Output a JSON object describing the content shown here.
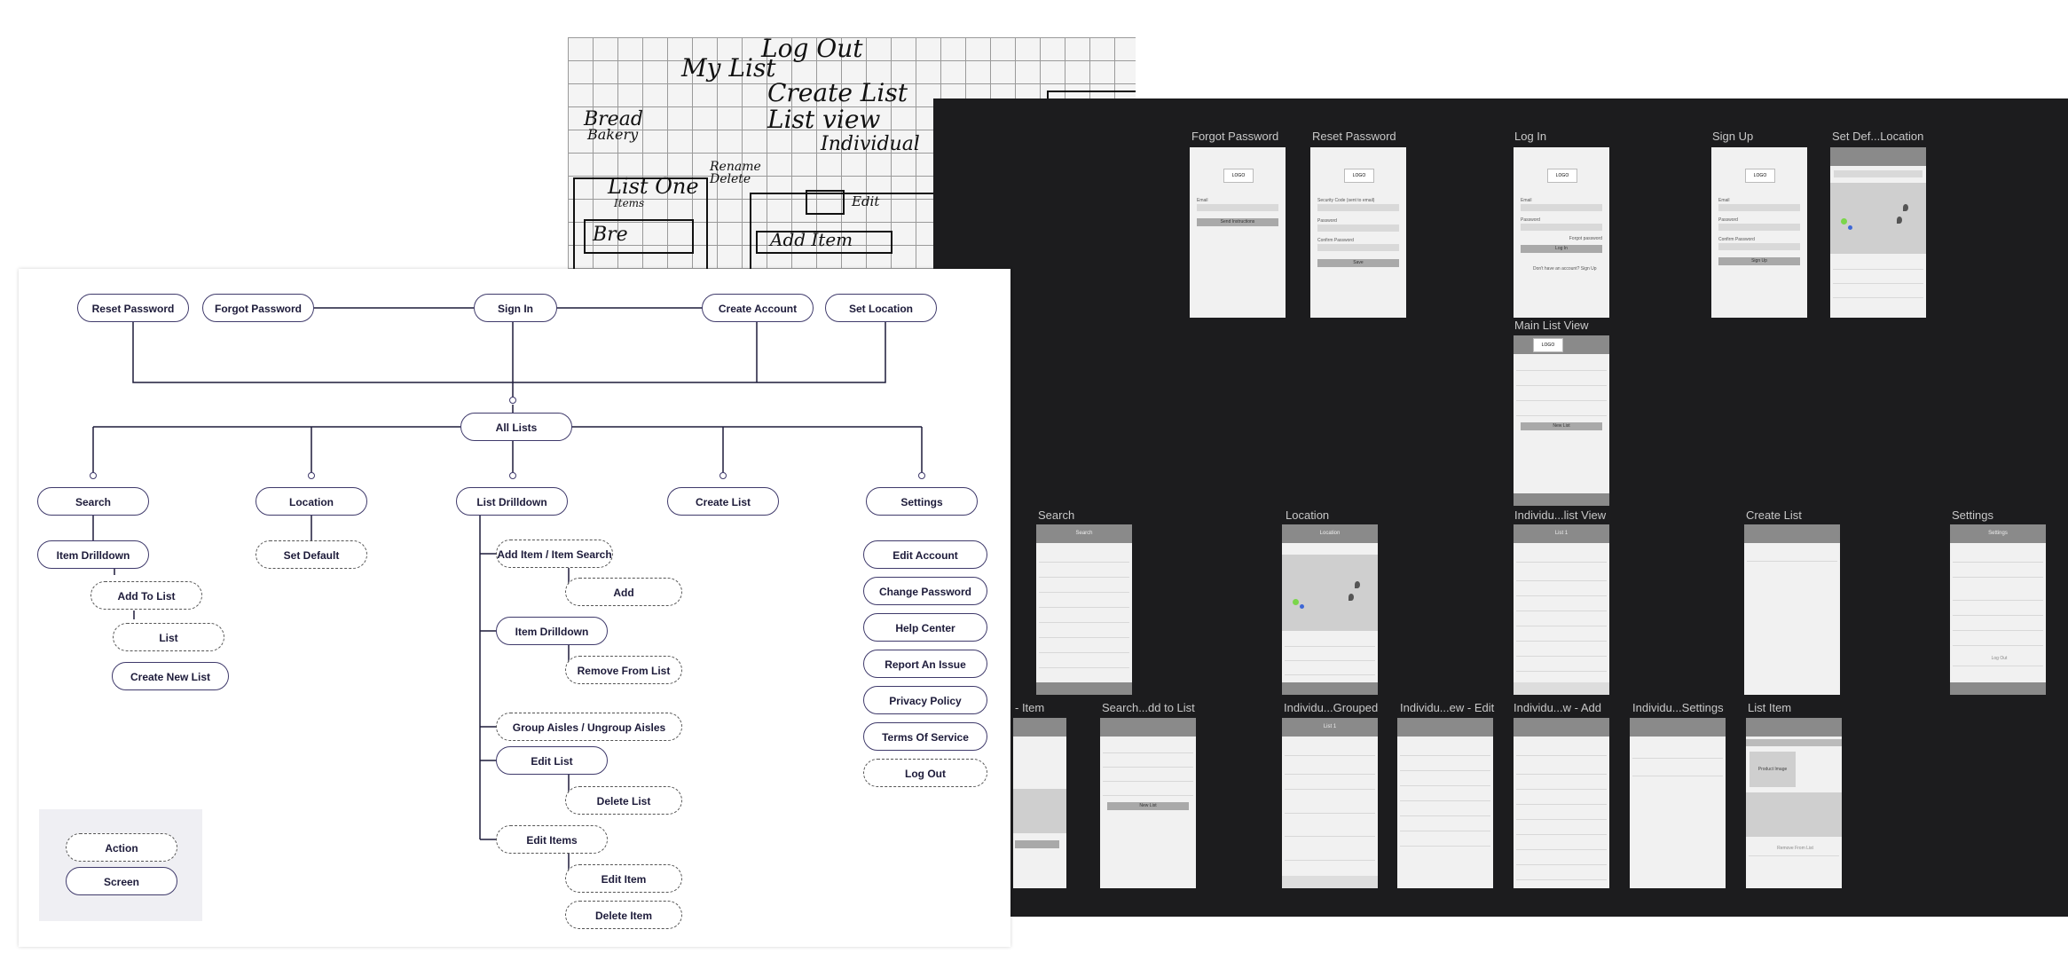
{
  "sketch": {
    "lines": [
      "Log Out",
      "My List",
      "Create List",
      "List view",
      "Individual",
      "Bread",
      "Bakery",
      "List One",
      "Rename",
      "Delete",
      "Items",
      "Bre",
      "Edit",
      "Add Item"
    ]
  },
  "flowchart": {
    "top_nodes": [
      "Reset Password",
      "Forgot Password",
      "Sign In",
      "Create Account",
      "Set Location"
    ],
    "hub": "All Lists",
    "branches": [
      "Search",
      "Location",
      "List Drilldown",
      "Create List",
      "Settings"
    ],
    "search_children": [
      "Item Drilldown",
      "Add To List",
      "List",
      "Create New List"
    ],
    "location_children": [
      "Set Default"
    ],
    "list_drilldown_children": [
      "Add Item / Item Search",
      "Add",
      "Item Drilldown",
      "Remove From List",
      "Group Aisles / Ungroup Aisles",
      "Edit List",
      "Delete List",
      "Edit Items",
      "Edit Item",
      "Delete Item"
    ],
    "settings_children": [
      "Edit Account",
      "Change Password",
      "Help Center",
      "Report An Issue",
      "Privacy Policy",
      "Terms Of Service",
      "Log Out"
    ],
    "legend": {
      "action": "Action",
      "screen": "Screen"
    }
  },
  "wireframes": {
    "titles": [
      "Forgot Password",
      "Reset Password",
      "Log In",
      "Sign Up",
      "Set Def...Location",
      "Main List View",
      "Search",
      "Location",
      "Individu...list View",
      "Create List",
      "Settings",
      "- Item",
      "Search...dd to List",
      "Individu...Grouped",
      "Individu...ew - Edit",
      "Individu...w - Add",
      "Individu...Settings",
      "List Item"
    ],
    "logo": "LOGO",
    "labels": {
      "email": "Email",
      "password": "Password",
      "confirm": "Confirm Password",
      "send": "Send Instructions",
      "login": "Log In",
      "signup": "Sign Up",
      "save": "Save",
      "new_list": "New List",
      "forgot": "Forgot password",
      "no_account": "Don't have an account? Sign Up",
      "reset_note": "Security Code (sent to email)",
      "log_out": "Log Out",
      "remove": "Remove From List",
      "product_image": "Product Image",
      "list1": "List 1",
      "search": "Search",
      "location": "Location",
      "settings": "Settings"
    }
  },
  "colors": {
    "dark_canvas": "#1c1c1e",
    "node_border": "#3f3a6b",
    "node_text": "#1d1b3a",
    "legend_bg": "#efeff3"
  }
}
